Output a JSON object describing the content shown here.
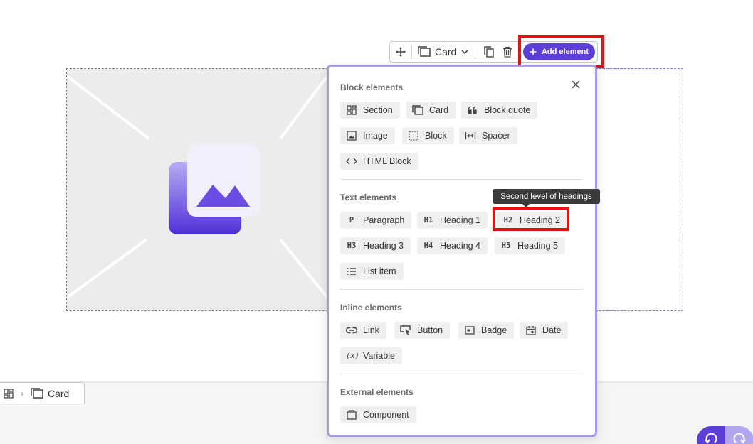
{
  "toolbar": {
    "type_label": "Card",
    "add_label": "Add element",
    "icons": [
      "move-icon",
      "card-icon",
      "chevron-down-icon",
      "copy-icon",
      "trash-icon",
      "plus-icon"
    ]
  },
  "panel": {
    "sections": [
      {
        "title": "Block elements",
        "items": [
          {
            "label": "Section",
            "icon": "section-icon"
          },
          {
            "label": "Card",
            "icon": "card-icon"
          },
          {
            "label": "Block quote",
            "icon": "quote-icon"
          },
          {
            "label": "Image",
            "icon": "image-icon"
          },
          {
            "label": "Block",
            "icon": "block-icon"
          },
          {
            "label": "Spacer",
            "icon": "spacer-icon"
          },
          {
            "label": "HTML Block",
            "icon": "code-icon"
          }
        ]
      },
      {
        "title": "Text elements",
        "items": [
          {
            "label": "Paragraph",
            "icon_text": "P"
          },
          {
            "label": "Heading 1",
            "icon_text": "H1"
          },
          {
            "label": "Heading 2",
            "icon_text": "H2"
          },
          {
            "label": "Heading 3",
            "icon_text": "H3"
          },
          {
            "label": "Heading 4",
            "icon_text": "H4"
          },
          {
            "label": "Heading 5",
            "icon_text": "H5"
          },
          {
            "label": "List item",
            "icon": "list-icon"
          }
        ]
      },
      {
        "title": "Inline elements",
        "items": [
          {
            "label": "Link",
            "icon": "link-icon"
          },
          {
            "label": "Button",
            "icon": "button-icon"
          },
          {
            "label": "Badge",
            "icon": "badge-icon"
          },
          {
            "label": "Date",
            "icon": "calendar-icon"
          },
          {
            "label": "Variable",
            "icon_text": "(x)"
          }
        ]
      },
      {
        "title": "External elements",
        "items": [
          {
            "label": "Component",
            "icon": "component-icon"
          }
        ]
      }
    ]
  },
  "tooltip": "Second level of headings",
  "breadcrumb": {
    "current": "Card"
  },
  "colors": {
    "accent": "#5b3fd6",
    "accent_light": "#b4a6ee",
    "panel_border": "#a999e4",
    "highlight": "#e01414"
  }
}
